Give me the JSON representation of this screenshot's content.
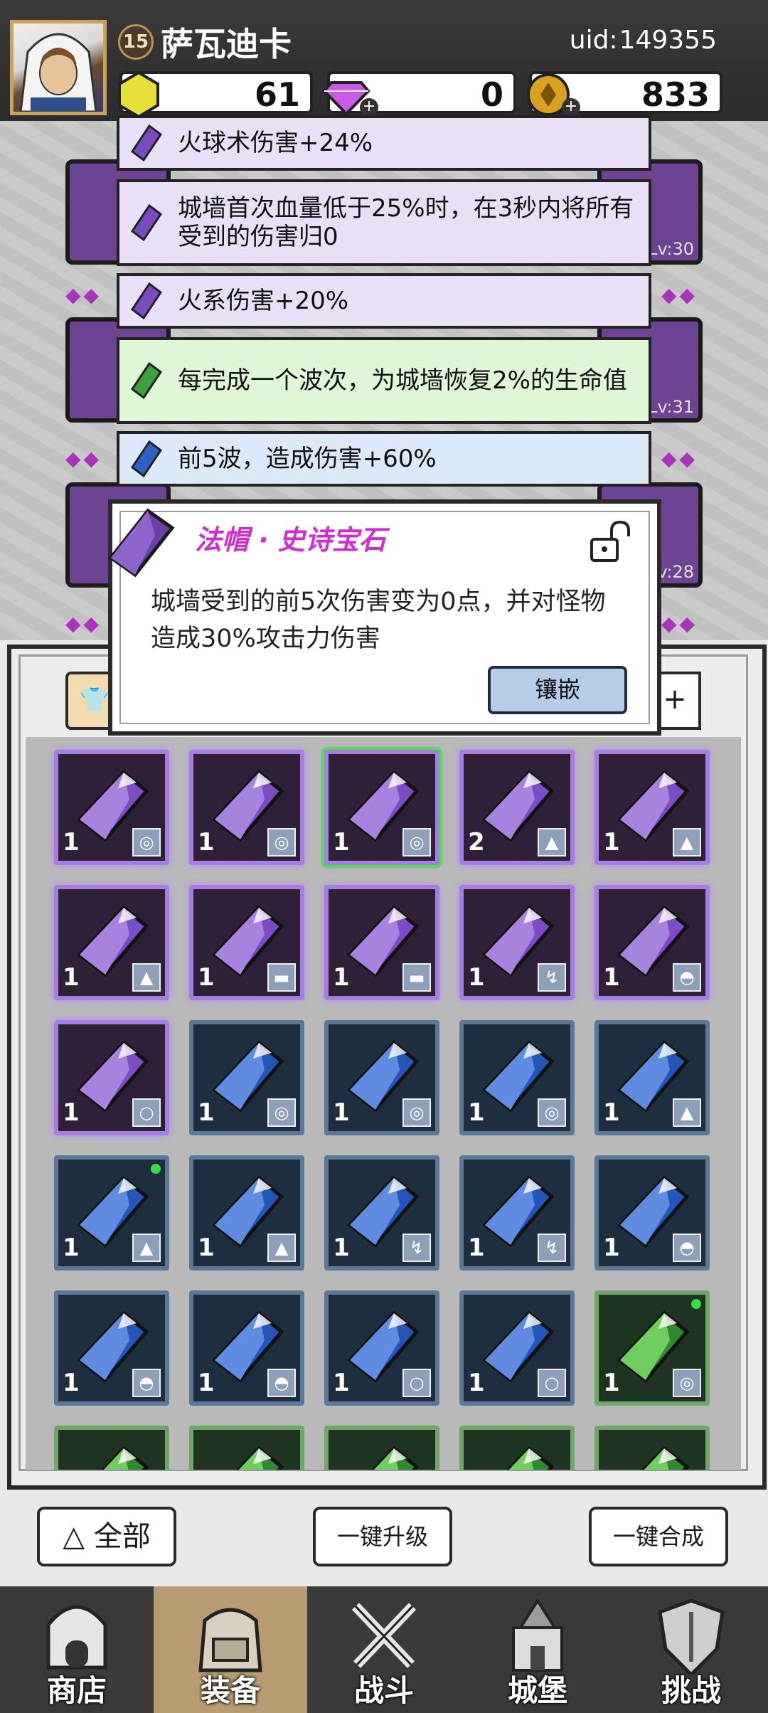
{
  "player": {
    "level": "15",
    "name": "萨瓦迪卡",
    "uid_label": "uid:",
    "uid": "149355"
  },
  "currencies": [
    {
      "name": "gold-crystal",
      "value": "61"
    },
    {
      "name": "purple-diamond",
      "value": "0"
    },
    {
      "name": "gold-coin",
      "value": "833"
    }
  ],
  "equipment_levels": [
    "Lv:30",
    "Lv:31",
    "Lv:28"
  ],
  "skills": [
    {
      "text": "火球术伤害+24%",
      "color": "#e9dff7",
      "gem": "purple"
    },
    {
      "text": "城墙首次血量低于25%时，在3秒内将所有受到的伤害归0",
      "color": "#e9dff7",
      "gem": "purple"
    },
    {
      "text": "火系伤害+20%",
      "color": "#e9dff7",
      "gem": "purple"
    },
    {
      "text": "每完成一个波次，为城墙恢复2%的生命值",
      "color": "#dff6d7",
      "gem": "green"
    },
    {
      "text": "前5波，造成伤害+60%",
      "color": "#dce9f8",
      "gem": "blue"
    }
  ],
  "gem_detail": {
    "title": "法帽 · 史诗宝石",
    "description": "城墙受到的前5次伤害变为0点，并对怪物造成30%攻击力伤害",
    "inlay_label": "镶嵌"
  },
  "inventory": [
    {
      "rarity": "epic",
      "qty": "1",
      "slot": "cape"
    },
    {
      "rarity": "epic",
      "qty": "1",
      "slot": "cape"
    },
    {
      "rarity": "epic",
      "qty": "1",
      "slot": "cape",
      "selected": true
    },
    {
      "rarity": "epic",
      "qty": "2",
      "slot": "armor"
    },
    {
      "rarity": "epic",
      "qty": "1",
      "slot": "armor"
    },
    {
      "rarity": "epic",
      "qty": "1",
      "slot": "armor"
    },
    {
      "rarity": "epic",
      "qty": "1",
      "slot": "boots"
    },
    {
      "rarity": "epic",
      "qty": "1",
      "slot": "boots"
    },
    {
      "rarity": "epic",
      "qty": "1",
      "slot": "weapon"
    },
    {
      "rarity": "epic",
      "qty": "1",
      "slot": "hat"
    },
    {
      "rarity": "epic",
      "qty": "1",
      "slot": "ring"
    },
    {
      "rarity": "rare",
      "qty": "1",
      "slot": "cape"
    },
    {
      "rarity": "rare",
      "qty": "1",
      "slot": "cape"
    },
    {
      "rarity": "rare",
      "qty": "1",
      "slot": "cape"
    },
    {
      "rarity": "rare",
      "qty": "1",
      "slot": "armor"
    },
    {
      "rarity": "rare",
      "qty": "1",
      "slot": "armor",
      "new": true
    },
    {
      "rarity": "rare",
      "qty": "1",
      "slot": "armor"
    },
    {
      "rarity": "rare",
      "qty": "1",
      "slot": "weapon"
    },
    {
      "rarity": "rare",
      "qty": "1",
      "slot": "weapon"
    },
    {
      "rarity": "rare",
      "qty": "1",
      "slot": "hat"
    },
    {
      "rarity": "rare",
      "qty": "1",
      "slot": "hat"
    },
    {
      "rarity": "rare",
      "qty": "1",
      "slot": "hat"
    },
    {
      "rarity": "rare",
      "qty": "1",
      "slot": "ring"
    },
    {
      "rarity": "rare",
      "qty": "1",
      "slot": "ring"
    },
    {
      "rarity": "uncommon",
      "qty": "1",
      "slot": "cape",
      "new": true
    },
    {
      "rarity": "uncommon",
      "qty": "",
      "slot": ""
    },
    {
      "rarity": "uncommon",
      "qty": "",
      "slot": ""
    },
    {
      "rarity": "uncommon",
      "qty": "",
      "slot": ""
    },
    {
      "rarity": "uncommon",
      "qty": "",
      "slot": ""
    },
    {
      "rarity": "uncommon",
      "qty": "",
      "slot": ""
    }
  ],
  "actions": {
    "all": "全部",
    "upgrade": "一键升级",
    "combine": "一键合成"
  },
  "nav": [
    {
      "label": "商店",
      "icon": "shop-icon",
      "active": false
    },
    {
      "label": "装备",
      "icon": "backpack-icon",
      "active": true
    },
    {
      "label": "战斗",
      "icon": "crossed-swords-icon",
      "active": false
    },
    {
      "label": "城堡",
      "icon": "castle-icon",
      "active": false
    },
    {
      "label": "挑战",
      "icon": "shield-icon",
      "active": false
    }
  ],
  "colors": {
    "epic": "#a67ee3",
    "rare": "#5c7897",
    "uncommon": "#6fa766",
    "title_magenta": "#d22bd2",
    "nav_active": "#b79c72"
  }
}
